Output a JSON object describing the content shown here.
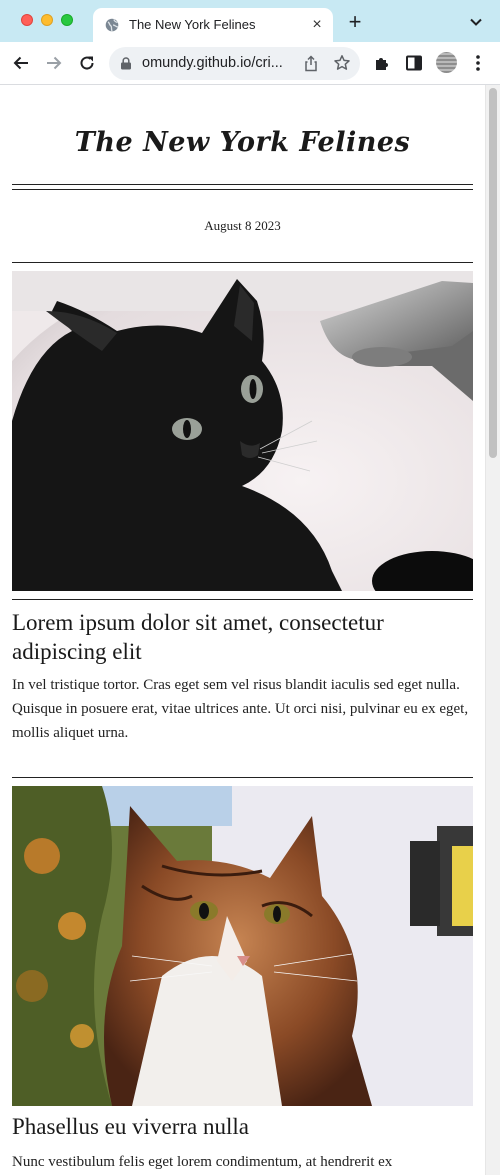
{
  "browser": {
    "tab_title": "The New York Felines",
    "url_display": "omundy.github.io/cri...",
    "new_tab_label": "+",
    "close_label": "×"
  },
  "page": {
    "masthead": "The New York Felines",
    "date": "August 8 2023",
    "articles": [
      {
        "headline": "Lorem ipsum dolor sit amet, consectetur adipiscing elit",
        "body": "In vel tristique tortor. Cras eget sem vel risus blandit iaculis sed eget nulla. Quisque in posuere erat, vitae ultrices ante. Ut orci nisi, pulvinar eu ex eget, mollis aliquet urna.",
        "image": "black-cat-in-sink-photo"
      },
      {
        "headline": "Phasellus eu viverra nulla",
        "body": "Nunc vestibulum felis eget lorem condimentum, at hendrerit ex",
        "image": "tabby-cat-outdoors-photo"
      }
    ]
  },
  "colors": {
    "tabbar_bg": "#c8e9f3",
    "text": "#1a1a1a"
  }
}
